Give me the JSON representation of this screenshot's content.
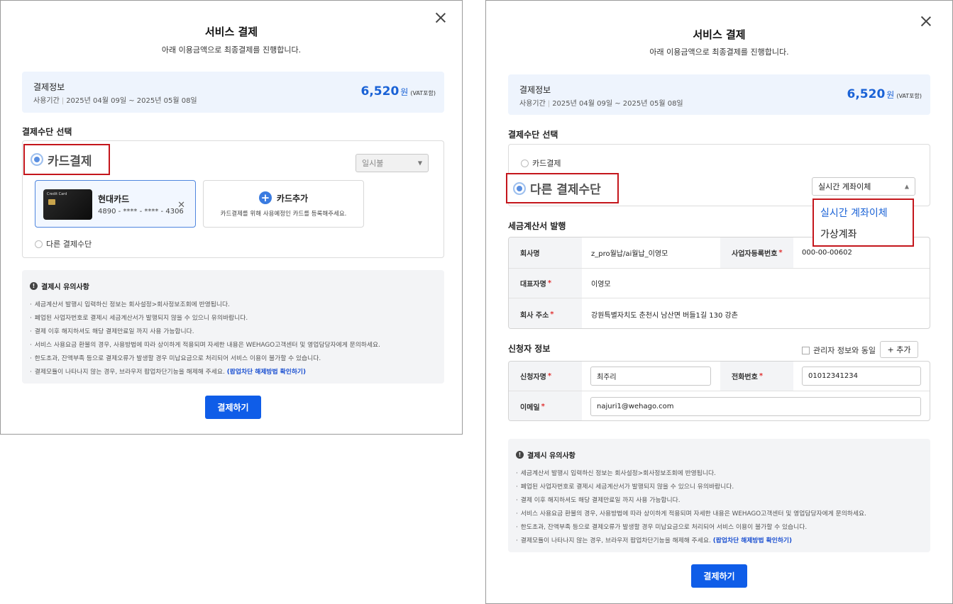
{
  "left": {
    "title": "서비스 결제",
    "subtitle": "아래 이용금액으로 최종결제를 진행합니다.",
    "info": {
      "label": "결제정보",
      "period_label": "사용기간",
      "period": "2025년 04월 09일 ~ 2025년 05월 08일",
      "amount": "6,520",
      "unit": "원",
      "vat": "(VAT포함)"
    },
    "method_title": "결제수단 선택",
    "card_option": "카드결제",
    "installment": "일시불",
    "card": {
      "image_text": "Credit Card",
      "name": "현대카드",
      "number": "4890 - **** - **** - 4306"
    },
    "add_card": {
      "label": "카드추가",
      "hint": "카드결제를 위해 사용예정인 카드를 등록해주세요."
    },
    "other_option": "다른 결제수단",
    "pay_button": "결제하기"
  },
  "right": {
    "title": "서비스 결제",
    "subtitle": "아래 이용금액으로 최종결제를 진행합니다.",
    "info": {
      "label": "결제정보",
      "period_label": "사용기간",
      "period": "2025년 04월 09일 ~ 2025년 05월 08일",
      "amount": "6,520",
      "unit": "원",
      "vat": "(VAT포함)"
    },
    "method_title": "결제수단 선택",
    "card_option": "카드결제",
    "other_option": "다른 결제수단",
    "method_select": "실시간 계좌이체",
    "dropdown_options": [
      "실시간 계좌이체",
      "가상계좌"
    ],
    "tax_title": "세금계산서 발행",
    "tax": {
      "company_label": "회사명",
      "company": "z_pro월납/ai월납_이영모",
      "bizno_label": "사업자등록번호",
      "bizno": "000-00-00602",
      "ceo_label": "대표자명",
      "ceo": "이영모",
      "address_label": "회사 주소",
      "address": "강원특별자치도 춘천시 남산면 버들1길 130 강촌"
    },
    "applicant_title": "신청자 정보",
    "same_as_admin": "관리자 정보와 동일",
    "add_button": "+ 추가",
    "applicant": {
      "name_label": "신청자명",
      "name": "최주리",
      "phone_label": "전화번호",
      "phone": "01012341234",
      "email_label": "이메일",
      "email": "najuri1@wehago.com"
    },
    "pay_button": "결제하기"
  },
  "notice": {
    "title": "결제시 유의사항",
    "items": [
      "세금계산서 발행시 입력하신 정보는 회사설정>회사정보조회에 반영됩니다.",
      "폐업된 사업자번호로 결제시 세금계산서가 발행되지 않을 수 있으니 유의바랍니다.",
      "결제 이후 해지하셔도 해당 결제만료일 까지 사용 가능합니다.",
      "서비스 사용요금 환불의 경우, 사용방법에 따라 상이하게 적용되며 자세한 내용은 WEHAGO고객센터 및 영업담당자에게 문의하세요.",
      "한도초과, 잔액부족 등으로 결제오류가 발생할 경우 미납요금으로 처리되어 서비스 이용이 불가할 수 있습니다.",
      "결제모듈이 나타나지 않는 경우, 브라우저 팝업차단기능을 해제해 주세요."
    ],
    "link": "(팝업차단 해제방법 확인하기)"
  }
}
